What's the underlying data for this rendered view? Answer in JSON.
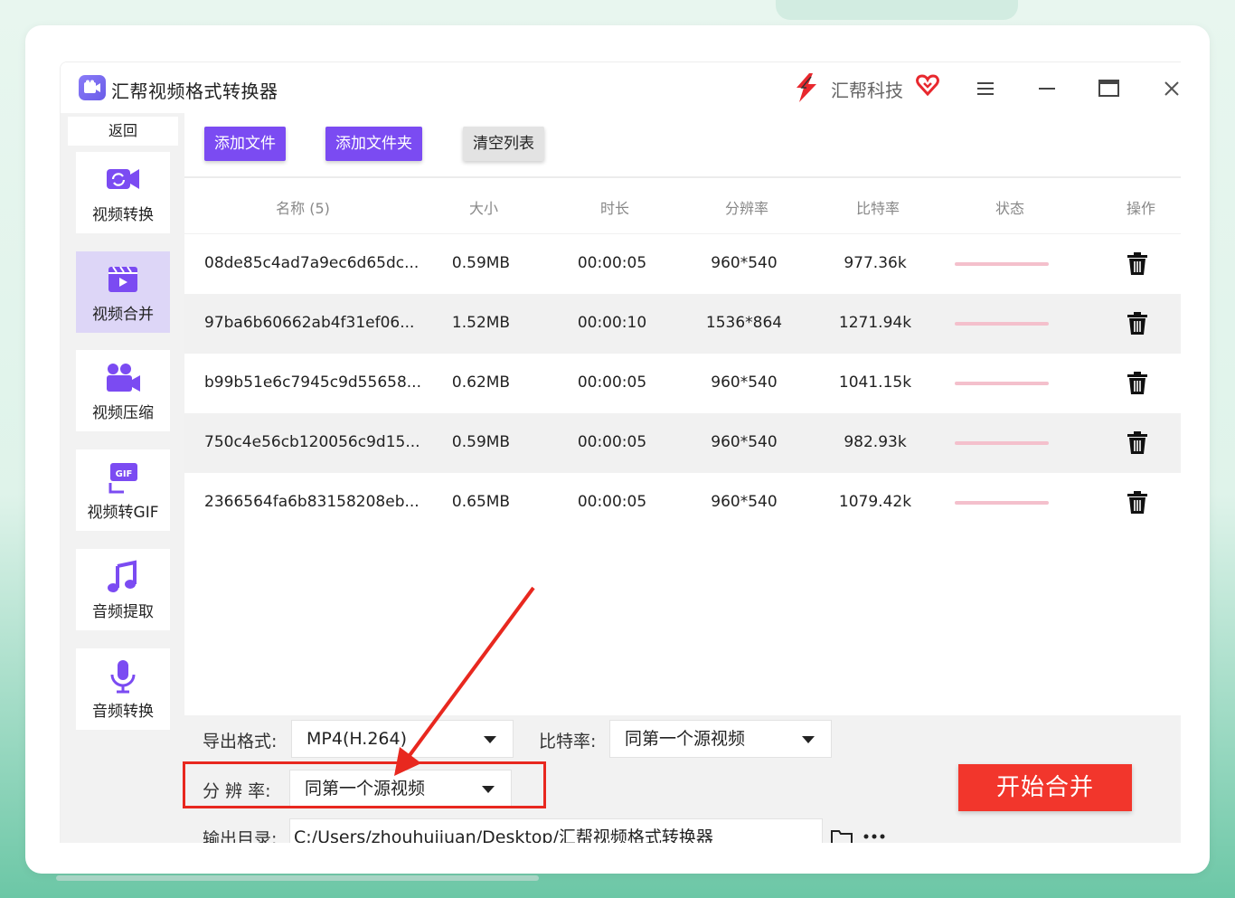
{
  "app": {
    "title": "汇帮视频格式转换器",
    "brand": "汇帮科技"
  },
  "sidebar": {
    "back_label": "返回",
    "items": [
      {
        "label": "视频转换",
        "icon": "video-convert-icon"
      },
      {
        "label": "视频合并",
        "icon": "video-merge-icon",
        "active": true
      },
      {
        "label": "视频压缩",
        "icon": "video-compress-icon"
      },
      {
        "label": "视频转GIF",
        "icon": "gif-icon"
      },
      {
        "label": "音频提取",
        "icon": "music-note-icon"
      },
      {
        "label": "音频转换",
        "icon": "microphone-icon"
      }
    ]
  },
  "toolbar": {
    "add_file": "添加文件",
    "add_folder": "添加文件夹",
    "clear_list": "清空列表"
  },
  "table": {
    "headers": {
      "name": "名称 (5)",
      "size": "大小",
      "duration": "时长",
      "resolution": "分辨率",
      "bitrate": "比特率",
      "status": "状态",
      "action": "操作"
    },
    "rows": [
      {
        "name": "08de85c4ad7a9ec6d65dc...",
        "size": "0.59MB",
        "duration": "00:00:05",
        "resolution": "960*540",
        "bitrate": "977.36k"
      },
      {
        "name": "97ba6b60662ab4f31ef06...",
        "size": "1.52MB",
        "duration": "00:00:10",
        "resolution": "1536*864",
        "bitrate": "1271.94k"
      },
      {
        "name": "b99b51e6c7945c9d55658...",
        "size": "0.62MB",
        "duration": "00:00:05",
        "resolution": "960*540",
        "bitrate": "1041.15k"
      },
      {
        "name": "750c4e56cb120056c9d15...",
        "size": "0.59MB",
        "duration": "00:00:05",
        "resolution": "960*540",
        "bitrate": "982.93k"
      },
      {
        "name": "2366564fa6b83158208eb...",
        "size": "0.65MB",
        "duration": "00:00:05",
        "resolution": "960*540",
        "bitrate": "1079.42k"
      }
    ]
  },
  "settings": {
    "format_label": "导出格式:",
    "format_value": "MP4(H.264)",
    "bitrate_label": "比特率:",
    "bitrate_value": "同第一个源视频",
    "resolution_label": "分 辨 率:",
    "resolution_value": "同第一个源视频",
    "output_label": "输出目录:",
    "output_value": "C:/Users/zhouhuijuan/Desktop/汇帮视频格式转换器"
  },
  "start_button": "开始合并",
  "colors": {
    "accent": "#7b4bf2",
    "start": "#f2362c",
    "annotation": "#e8281f"
  }
}
